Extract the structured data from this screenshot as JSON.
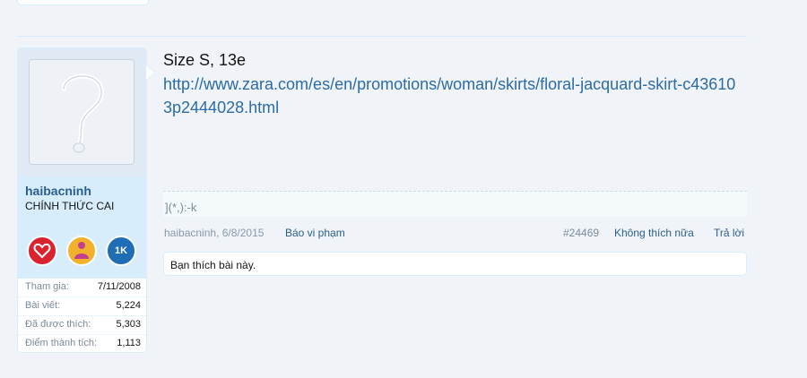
{
  "post": {
    "user": {
      "username": "haibacninh",
      "title": "CHÍNH THỨC CAI",
      "avatar_icon": "default-avatar-question-mark",
      "trophies": [
        {
          "icon": "heart-trophy-icon",
          "color": "#d9232f"
        },
        {
          "icon": "people-trophy-icon",
          "color": "#f2a51a"
        },
        {
          "icon": "1k-trophy-icon",
          "color": "#1f6db5",
          "label": "1K"
        }
      ],
      "stats": [
        {
          "label": "Tham gia:",
          "value": "7/11/2008"
        },
        {
          "label": "Bài viết:",
          "value": "5,224"
        },
        {
          "label": "Đã được thích:",
          "value": "5,303"
        },
        {
          "label": "Điểm thành tích:",
          "value": "1,113"
        }
      ]
    },
    "content": {
      "line1": "Size S, 13e",
      "link": "http://www.zara.com/es/en/promotions/woman/skirts/floral-jacquard-skirt-c436103p2444028.html"
    },
    "signature": "](*,):-k",
    "meta": {
      "author": "haibacninh",
      "date": "6/8/2015",
      "report": "Báo vi phạm",
      "post_number": "#24469",
      "unlike": "Không thích nữa",
      "reply": "Trả lời"
    },
    "likes_text": "Bạn thích bài này."
  }
}
